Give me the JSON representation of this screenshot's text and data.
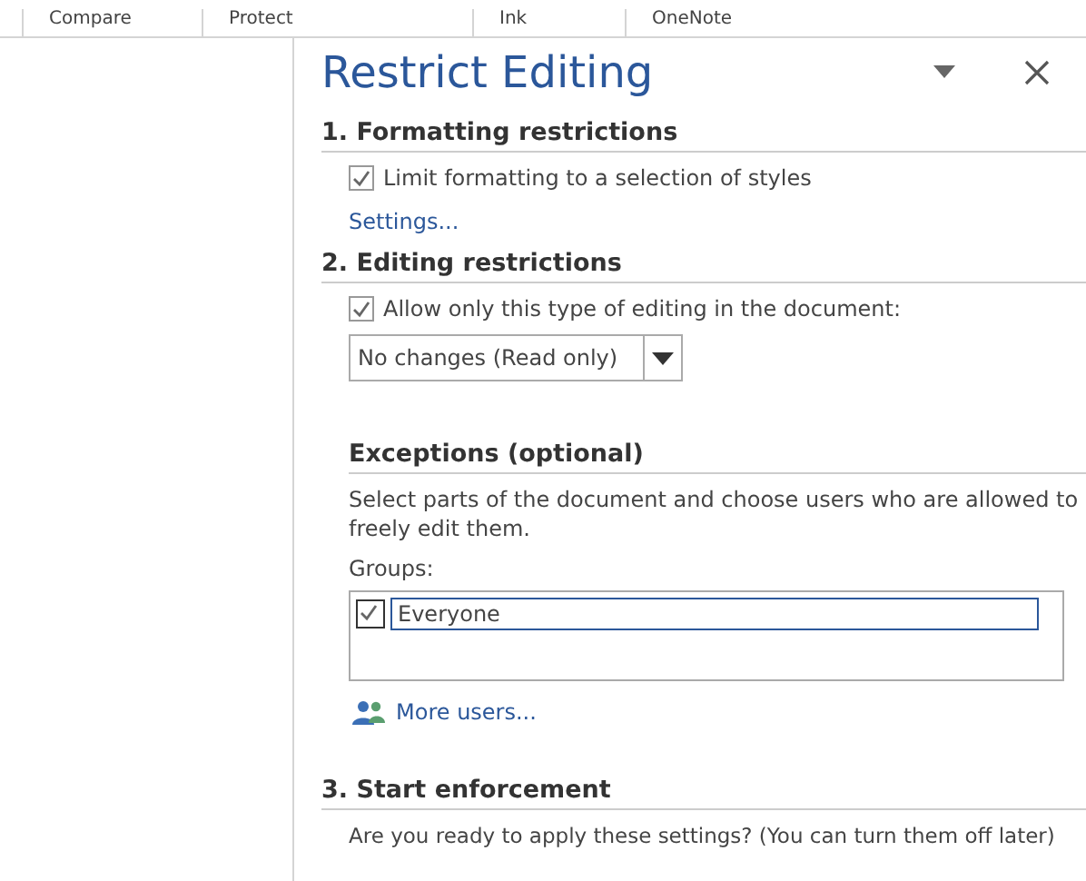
{
  "ribbon": {
    "groups": [
      "Compare",
      "Protect",
      "Ink",
      "OneNote"
    ]
  },
  "pane": {
    "title": "Restrict Editing",
    "formatting": {
      "heading": "1. Formatting restrictions",
      "checkbox": {
        "label": "Limit formatting to a selection of styles",
        "checked": true
      },
      "link": "Settings..."
    },
    "editing": {
      "heading": "2. Editing restrictions",
      "checkbox": {
        "label": "Allow only this type of editing in the document:",
        "checked": true
      },
      "dropdown": {
        "value": "No changes (Read only)"
      }
    },
    "exceptions": {
      "heading": "Exceptions (optional)",
      "description": "Select parts of the document and choose users who are allowed to freely edit them.",
      "groups_label": "Groups:",
      "groups": [
        {
          "name": "Everyone",
          "checked": true
        }
      ],
      "link": "More users..."
    },
    "enforcement": {
      "heading": "3. Start enforcement",
      "question": "Are you ready to apply these settings? (You can turn them off later)"
    }
  }
}
